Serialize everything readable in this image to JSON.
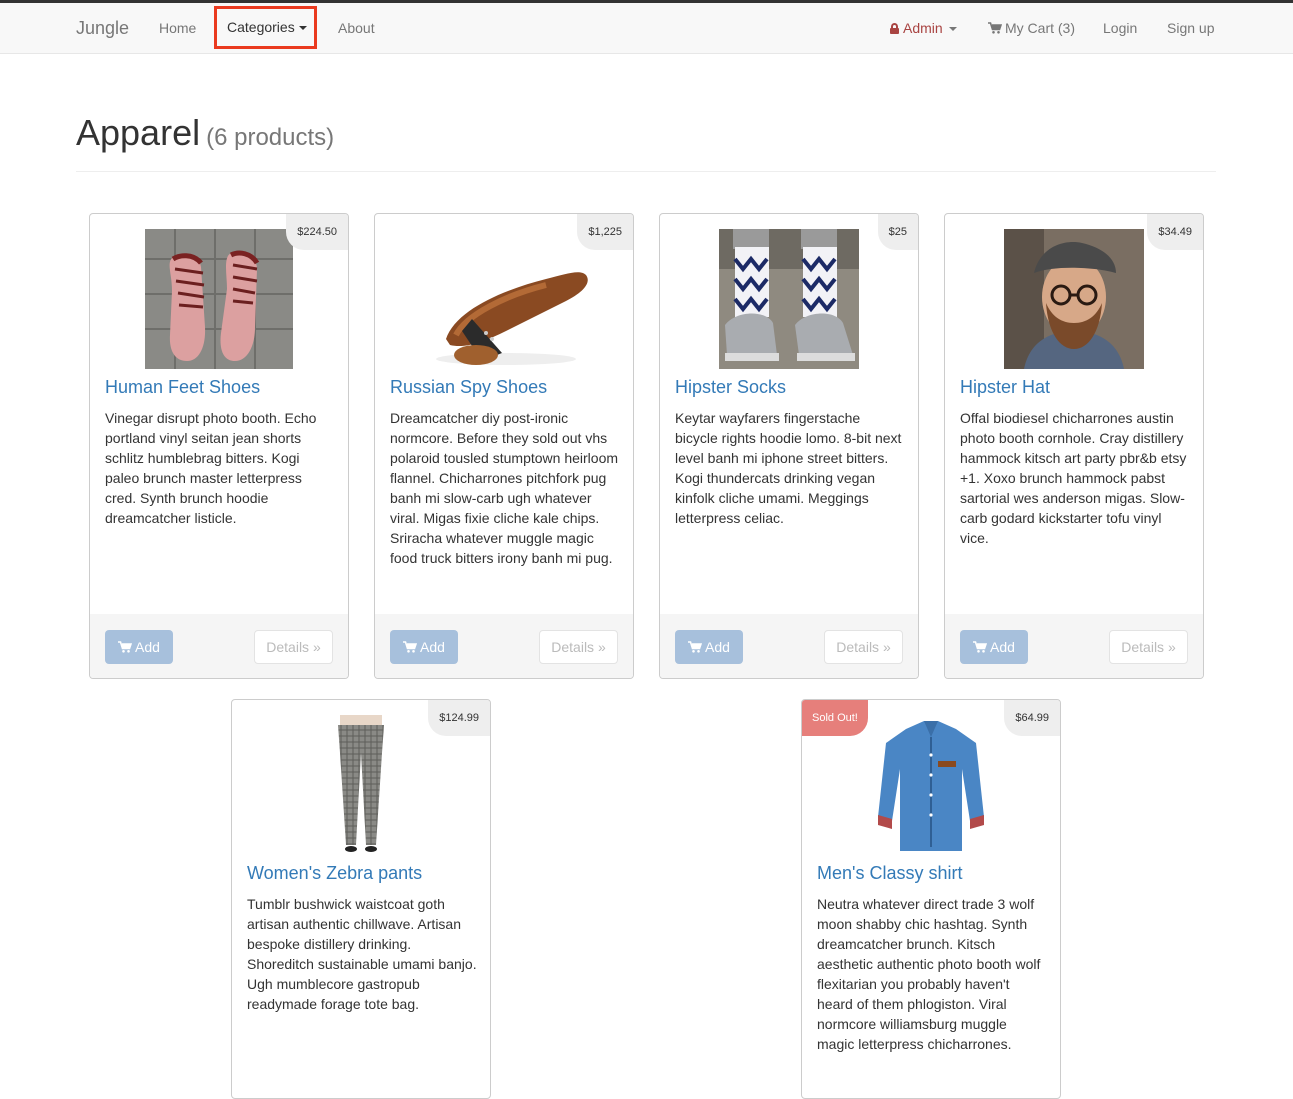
{
  "navbar": {
    "brand": "Jungle",
    "home": "Home",
    "categories": "Categories",
    "about": "About",
    "admin": "Admin",
    "cart": "My Cart (3)",
    "login": "Login",
    "signup": "Sign up"
  },
  "page": {
    "title": "Apparel",
    "count": "(6 products)"
  },
  "colors": {
    "link": "#337ab7",
    "admin": "#a94442",
    "highlight": "#ea3a1f",
    "soldout": "#e67f7b"
  },
  "products": [
    {
      "name": "Human Feet Shoes",
      "price": "$224.50",
      "description": "Vinegar disrupt photo booth. Echo portland vinyl seitan jean shorts schlitz humblebrag bitters. Kogi paleo brunch master letterpress cred. Synth brunch hoodie dreamcatcher listicle.",
      "add": "Add",
      "details": "Details »"
    },
    {
      "name": "Russian Spy Shoes",
      "price": "$1,225",
      "description": "Dreamcatcher diy post-ironic normcore. Before they sold out vhs polaroid tousled stumptown heirloom flannel. Chicharrones pitchfork pug banh mi slow-carb ugh whatever viral. Migas fixie cliche kale chips. Sriracha whatever muggle magic food truck bitters irony banh mi pug.",
      "add": "Add",
      "details": "Details »"
    },
    {
      "name": "Hipster Socks",
      "price": "$25",
      "description": "Keytar wayfarers fingerstache bicycle rights hoodie lomo. 8-bit next level banh mi iphone street bitters. Kogi thundercats drinking vegan kinfolk cliche umami. Meggings letterpress celiac.",
      "add": "Add",
      "details": "Details »"
    },
    {
      "name": "Hipster Hat",
      "price": "$34.49",
      "description": "Offal biodiesel chicharrones austin photo booth cornhole. Cray distillery hammock kitsch art party pbr&b etsy +1. Xoxo brunch hammock pabst sartorial wes anderson migas. Slow-carb godard kickstarter tofu vinyl vice.",
      "add": "Add",
      "details": "Details »"
    },
    {
      "name": "Women's Zebra pants",
      "price": "$124.99",
      "description": "Tumblr bushwick waistcoat goth artisan authentic chillwave. Artisan bespoke distillery drinking. Shoreditch sustainable umami banjo. Ugh mumblecore gastropub readymade forage tote bag."
    },
    {
      "name": "Men's Classy shirt",
      "price": "$64.99",
      "badge": "Sold Out!",
      "description": "Neutra whatever direct trade 3 wolf moon shabby chic hashtag. Synth dreamcatcher brunch. Kitsch aesthetic authentic photo booth wolf flexitarian you probably haven't heard of them phlogiston. Viral normcore williamsburg muggle magic letterpress chicharrones."
    }
  ]
}
